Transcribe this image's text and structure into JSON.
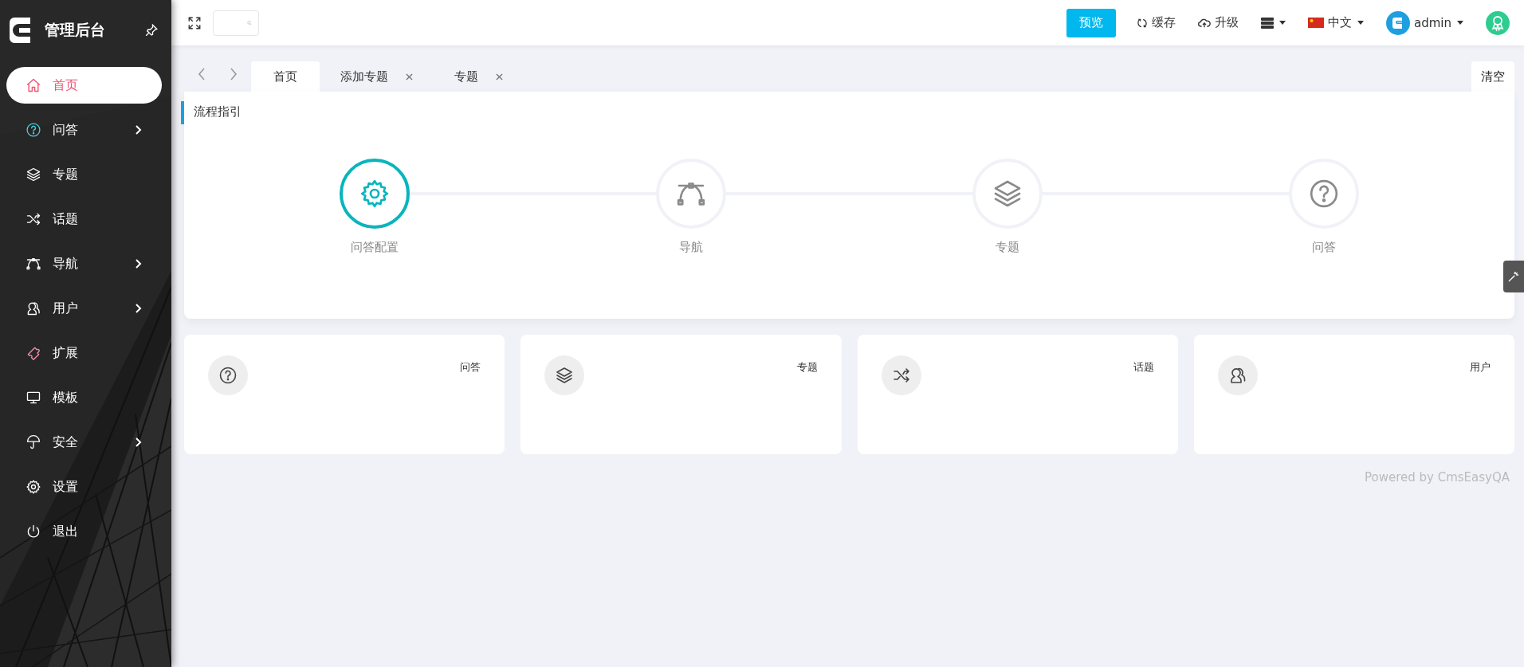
{
  "sidebar": {
    "title": "管理后台",
    "items": [
      {
        "label": "首页",
        "selected": true,
        "has_submenu": false
      },
      {
        "label": "问答",
        "selected": false,
        "has_submenu": true
      },
      {
        "label": "专题",
        "selected": false,
        "has_submenu": false
      },
      {
        "label": "话题",
        "selected": false,
        "has_submenu": false
      },
      {
        "label": "导航",
        "selected": false,
        "has_submenu": true
      },
      {
        "label": "用户",
        "selected": false,
        "has_submenu": true
      },
      {
        "label": "扩展",
        "selected": false,
        "has_submenu": false
      },
      {
        "label": "模板",
        "selected": false,
        "has_submenu": false
      },
      {
        "label": "安全",
        "selected": false,
        "has_submenu": true
      },
      {
        "label": "设置",
        "selected": false,
        "has_submenu": false
      },
      {
        "label": "退出",
        "selected": false,
        "has_submenu": false
      }
    ]
  },
  "topbar": {
    "preview_button": "预览",
    "actions": [
      {
        "label": "缓存"
      },
      {
        "label": "升级"
      }
    ],
    "language": "中文",
    "user": "admin"
  },
  "tabs": [
    {
      "label": "首页",
      "selected": true,
      "closable": false
    },
    {
      "label": "添加专题",
      "selected": false,
      "closable": true
    },
    {
      "label": "专题",
      "selected": false,
      "closable": true
    }
  ],
  "clear_button": "清空",
  "guide": {
    "title": "流程指引",
    "steps": [
      {
        "label": "问答配置",
        "selected": true
      },
      {
        "label": "导航",
        "selected": false
      },
      {
        "label": "专题",
        "selected": false
      },
      {
        "label": "问答",
        "selected": false
      }
    ]
  },
  "cards": [
    {
      "label": "问答"
    },
    {
      "label": "专题"
    },
    {
      "label": "话题"
    },
    {
      "label": "用户"
    }
  ],
  "footer": "Powered by CmsEasyQA"
}
